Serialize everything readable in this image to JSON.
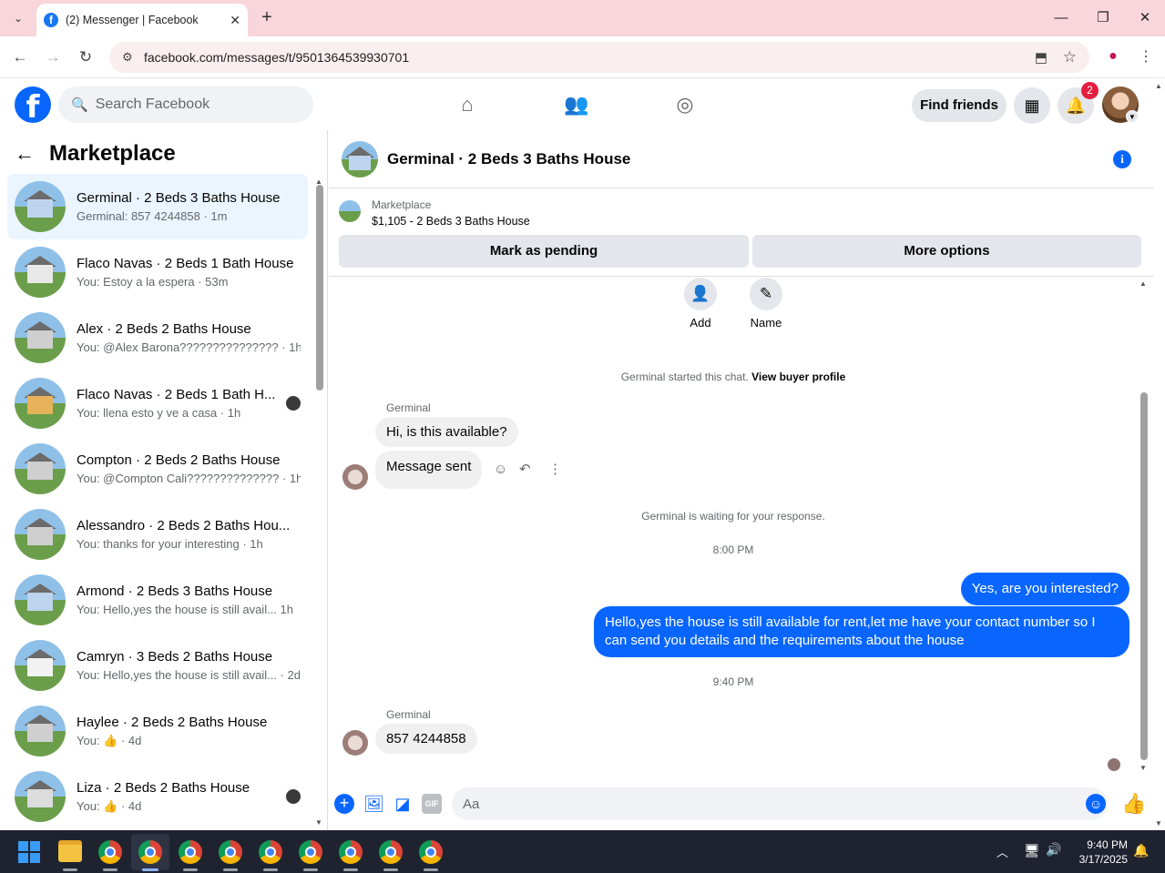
{
  "browser": {
    "tab_title": "(2) Messenger | Facebook",
    "url": "facebook.com/messages/t/9501364539930701"
  },
  "fb_header": {
    "search_placeholder": "Search Facebook",
    "find_friends": "Find friends",
    "notif_count": "2"
  },
  "left_panel": {
    "title": "Marketplace",
    "conversations": [
      {
        "name": "Germinal · 2 Beds 3 Baths House",
        "snippet": "Germinal: 857 4244858 · 1m",
        "active": true
      },
      {
        "name": "Flaco Navas · 2 Beds 1 Bath House",
        "snippet": "You: Estoy a la espera · 53m"
      },
      {
        "name": "Alex · 2 Beds 2 Baths House",
        "snippet": "You: @Alex Barona??????????????? · 1h"
      },
      {
        "name": "Flaco Navas · 2 Beds 1 Bath H...",
        "snippet": "You: llena esto y ve a casa · 1h"
      },
      {
        "name": "Compton · 2 Beds 2 Baths House",
        "snippet": "You: @Compton Cali?????????????? · 1h"
      },
      {
        "name": "Alessandro · 2 Beds 2 Baths Hou...",
        "snippet": "You: thanks for your interesting · 1h"
      },
      {
        "name": "Armond · 2 Beds 3 Baths House",
        "snippet": "You: Hello,yes the house is still avail... 1h"
      },
      {
        "name": "Camryn · 3 Beds 2 Baths House",
        "snippet": "You: Hello,yes the house is still avail... · 2d"
      },
      {
        "name": "Haylee · 2 Beds 2 Baths House",
        "snippet": "You: 👍 · 4d"
      },
      {
        "name": "Liza · 2 Beds 2 Baths House",
        "snippet": "You: 👍 · 4d"
      }
    ]
  },
  "chat": {
    "title": "Germinal · 2 Beds 3 Baths House",
    "listing_source": "Marketplace",
    "listing_desc": "$1,105 - 2 Beds 3 Baths House",
    "mark_pending": "Mark as pending",
    "more_options": "More options",
    "add_label": "Add",
    "name_label": "Name",
    "started_text": "Germinal started this chat.",
    "view_profile": "View buyer profile",
    "sender_name": "Germinal",
    "msg1": "Hi, is this available?",
    "msg2": "Message sent",
    "waiting_text": "Germinal is waiting for your response.",
    "time1": "8:00 PM",
    "out1": "Yes, are you interested?",
    "out2": "Hello,yes the house is still available for rent,let me have your contact number   so I can send you details and the requirements about the house",
    "time2": "9:40 PM",
    "msg3": "857 4244858",
    "input_placeholder": "Aa"
  },
  "taskbar": {
    "time": "9:40 PM",
    "date": "3/17/2025"
  }
}
